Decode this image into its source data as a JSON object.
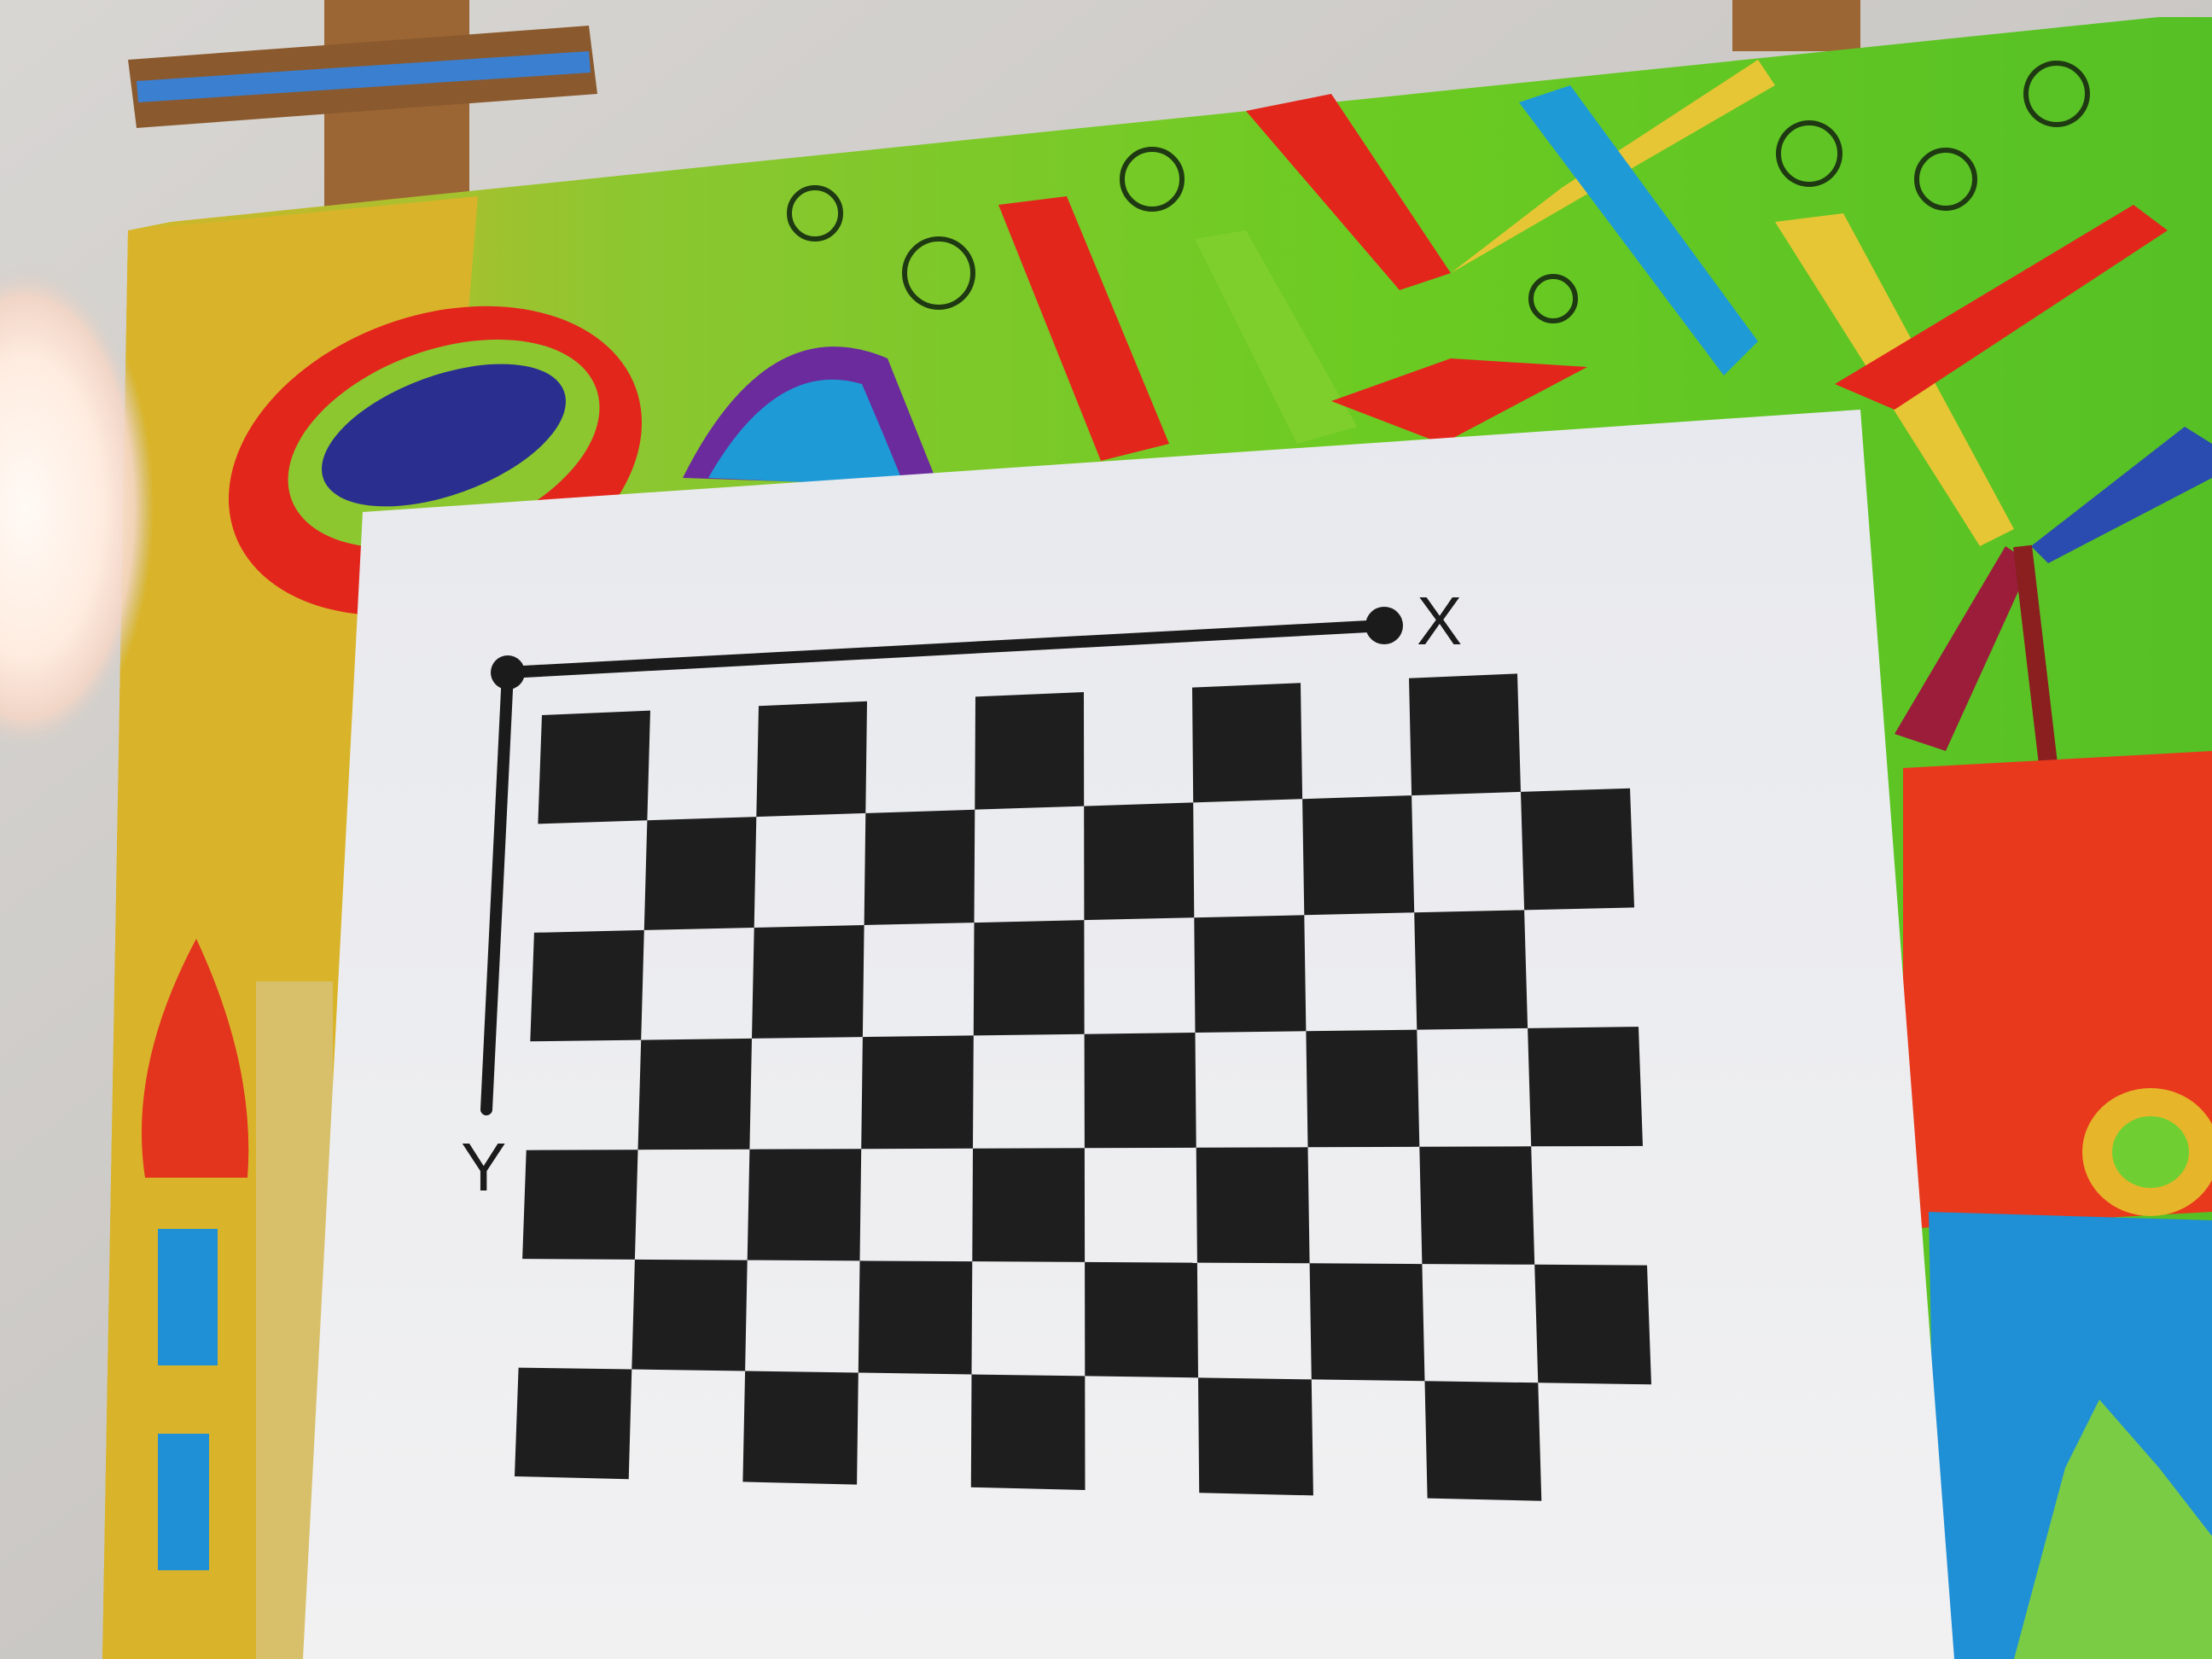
{
  "scene": {
    "description_role": "photo",
    "colors": {
      "wall": "#cfcdca",
      "easel_wood": "#a06a32",
      "canvas_green": "#63c424",
      "canvas_yellow": "#d9b42a",
      "canvas_red": "#e3261c",
      "canvas_blue": "#1f8fd6",
      "board_white": "#eeeff1",
      "square_black": "#1e1e1e",
      "flash_glow": "#fff1e6"
    },
    "calibration_board": {
      "axis_x_label": "X",
      "axis_y_label": "Y",
      "rows": 7,
      "cols": 10
    }
  }
}
